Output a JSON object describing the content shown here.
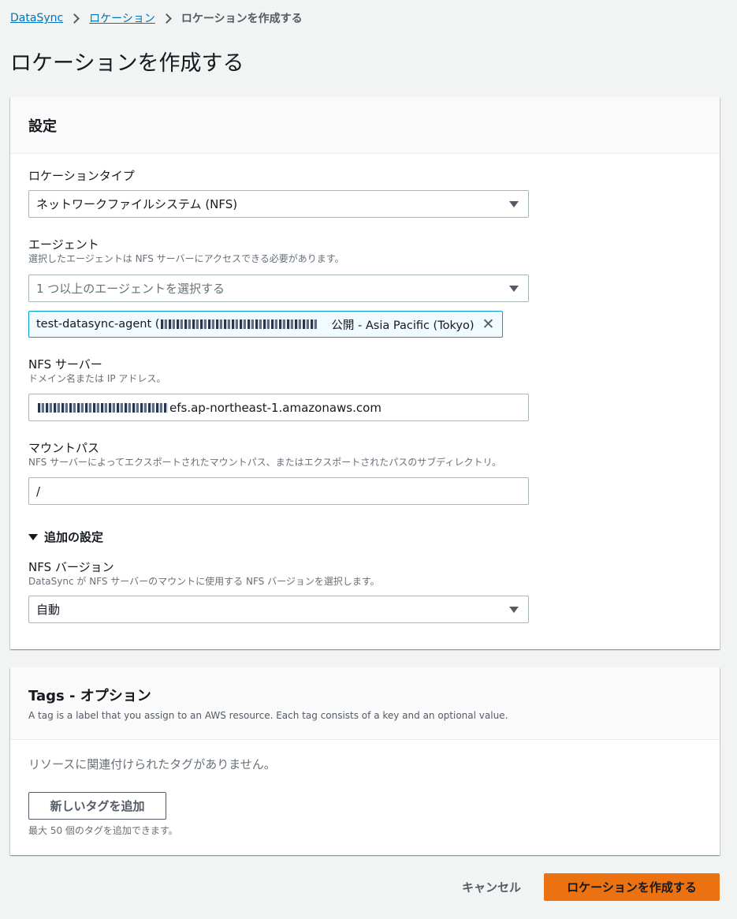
{
  "breadcrumb": {
    "items": [
      "DataSync",
      "ロケーション"
    ],
    "current": "ロケーションを作成する"
  },
  "page_title": "ロケーションを作成する",
  "settings": {
    "title": "設定",
    "location_type": {
      "label": "ロケーションタイプ",
      "value": "ネットワークファイルシステム (NFS)"
    },
    "agent": {
      "label": "エージェント",
      "description": "選択したエージェントは NFS サーバーにアクセスできる必要があります。",
      "placeholder": "1 つ以上のエージェントを選択する",
      "token_name": "test-datasync-agent (",
      "token_suffix": "公開 - Asia Pacific (Tokyo)"
    },
    "nfs_server": {
      "label": "NFS サーバー",
      "description": "ドメイン名または IP アドレス。",
      "value_suffix": "efs.ap-northeast-1.amazonaws.com"
    },
    "mount_path": {
      "label": "マウントパス",
      "description": "NFS サーバーによってエクスポートされたマウントパス、またはエクスポートされたパスのサブディレクトリ。",
      "value": "/"
    },
    "additional": {
      "label": "追加の設定"
    },
    "nfs_version": {
      "label": "NFS バージョン",
      "description": "DataSync が NFS サーバーのマウントに使用する NFS バージョンを選択します。",
      "value": "自動"
    }
  },
  "tags": {
    "title": "Tags - オプション",
    "description": "A tag is a label that you assign to an AWS resource. Each tag consists of a key and an optional value.",
    "empty_text": "リソースに関連付けられたタグがありません。",
    "add_button": "新しいタグを追加",
    "limit_text": "最大 50 個のタグを追加できます。"
  },
  "footer": {
    "cancel_label": "キャンセル",
    "create_label": "ロケーションを作成する"
  },
  "colors": {
    "primary": "#ec7211",
    "link": "#0073bb",
    "token_border": "#00a1c9"
  }
}
